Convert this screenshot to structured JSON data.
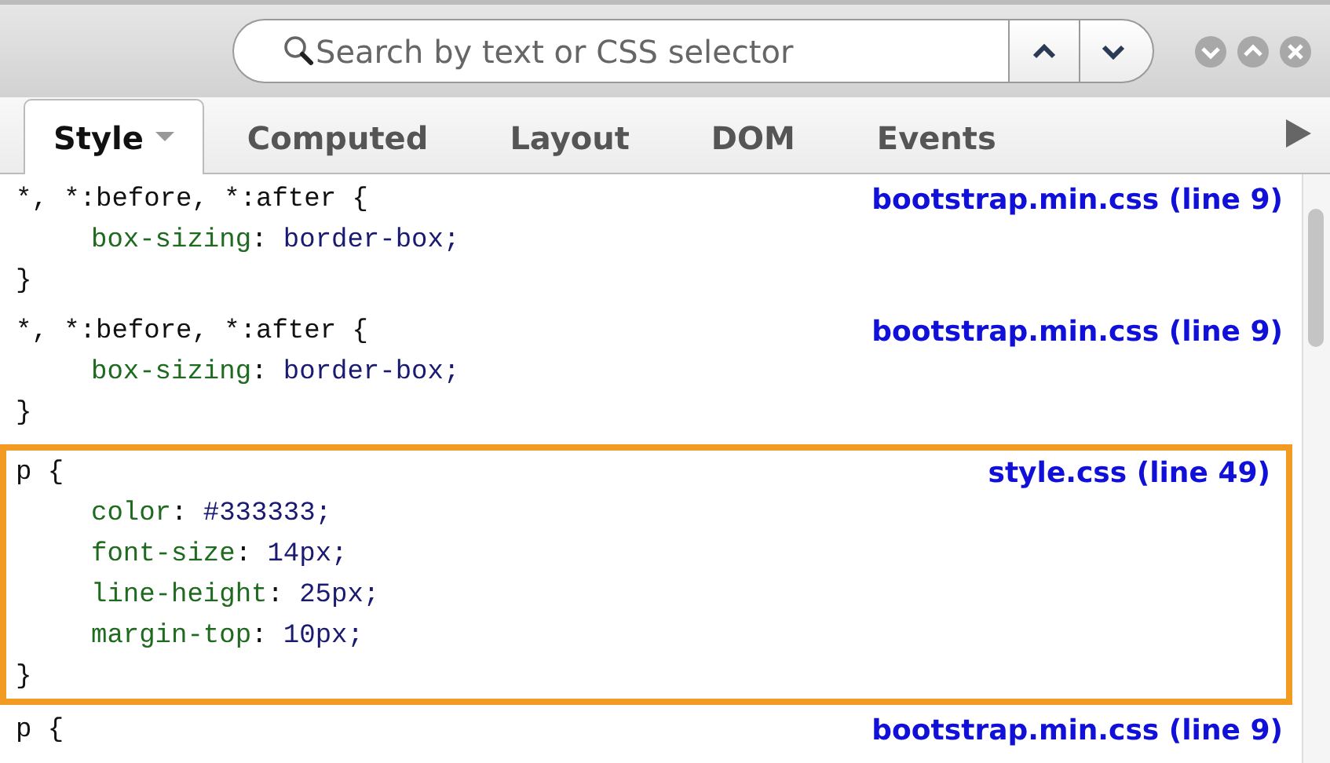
{
  "search": {
    "placeholder": "Search by text or CSS selector"
  },
  "tabs": [
    {
      "label": "Style",
      "selected": true,
      "dropdown": true
    },
    {
      "label": "Computed",
      "selected": false,
      "dropdown": false
    },
    {
      "label": "Layout",
      "selected": false,
      "dropdown": false
    },
    {
      "label": "DOM",
      "selected": false,
      "dropdown": false
    },
    {
      "label": "Events",
      "selected": false,
      "dropdown": false
    }
  ],
  "rules": [
    {
      "selector": "*, *:before, *:after {",
      "source": "bootstrap.min.css (line 9)",
      "highlighted": false,
      "declarations": [
        {
          "property": "box-sizing",
          "separator": ":",
          "value": "border-box;"
        }
      ],
      "close": "}"
    },
    {
      "selector": "*, *:before, *:after {",
      "source": "bootstrap.min.css (line 9)",
      "highlighted": false,
      "declarations": [
        {
          "property": "box-sizing",
          "separator": ":",
          "value": "border-box;"
        }
      ],
      "close": "}"
    },
    {
      "selector": "p {",
      "source": "style.css (line 49)",
      "highlighted": true,
      "declarations": [
        {
          "property": "color",
          "separator": ":",
          "value": "#333333;"
        },
        {
          "property": "font-size",
          "separator": ":",
          "value": "14px;"
        },
        {
          "property": "line-height",
          "separator": ":",
          "value": "25px;"
        },
        {
          "property": "margin-top",
          "separator": ":",
          "value": "10px;"
        }
      ],
      "close": "}"
    },
    {
      "selector": "p {",
      "source": "bootstrap.min.css (line 9)",
      "highlighted": false
    }
  ]
}
